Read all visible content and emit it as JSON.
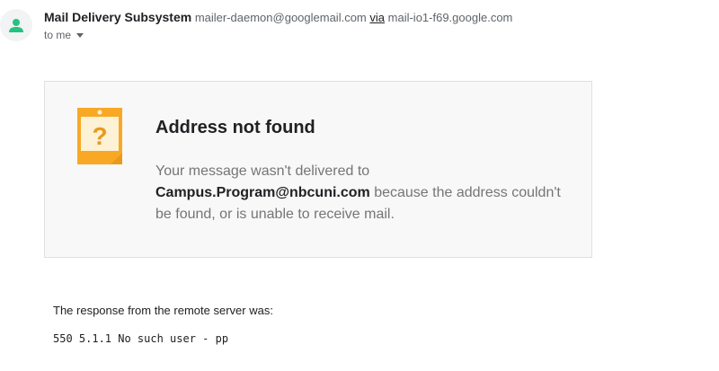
{
  "header": {
    "sender_name": "Mail Delivery Subsystem",
    "sender_email": "mailer-daemon@googlemail.com",
    "via_label": "via",
    "via_host": "mail-io1-f69.google.com",
    "recipient": "to me"
  },
  "card": {
    "title": "Address not found",
    "body_prefix": "Your message wasn't delivered to",
    "address": "Campus.Program@nbcuni.com",
    "body_suffix": " because the address couldn't be found, or is unable to receive mail."
  },
  "response": {
    "label": "The response from the remote server was:",
    "code": "550 5.1.1 No such user - pp"
  },
  "icons": {
    "avatar": "person-icon",
    "warning": "question-note-icon",
    "recipient_toggle": "chevron-down-icon"
  },
  "colors": {
    "avatar_person": "#26c281",
    "note_orange": "#f9a825",
    "note_inner": "#fdf1d6",
    "note_mark": "#e89b1a"
  }
}
